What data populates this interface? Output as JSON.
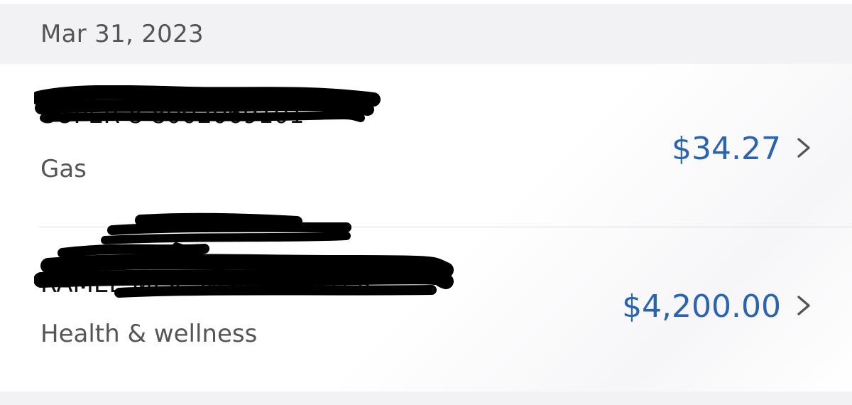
{
  "section": {
    "date": "Mar 31, 2023"
  },
  "transactions": [
    {
      "merchant": "SUPER 8 8002069101",
      "category": "Gas",
      "amount": "$34.27"
    },
    {
      "merchant": "RAMEE MISC NORS CENTER",
      "category": "Health & wellness",
      "amount": "$4,200.00"
    }
  ],
  "icons": {
    "chevron": "chevron-right-icon",
    "redaction": "scribble-redaction"
  },
  "colors": {
    "amount": "#2a63b0",
    "header_bg": "#f2f2f4",
    "secondary_text": "#555559",
    "chevron": "#555559",
    "redaction": "#000000"
  }
}
